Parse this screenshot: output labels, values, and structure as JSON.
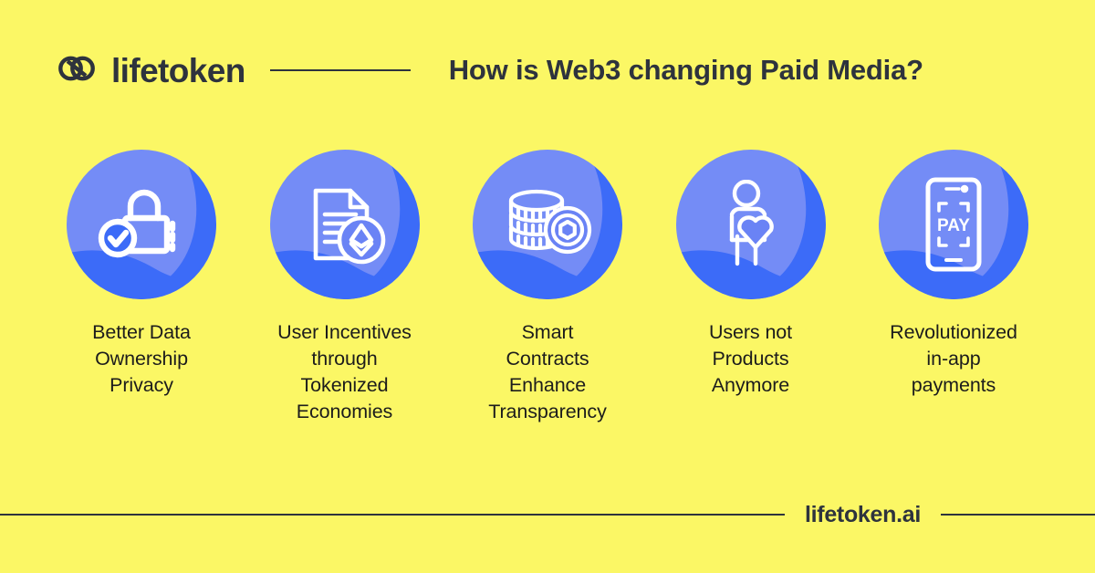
{
  "page": {
    "background_color": "#FBF765",
    "text_color": "#2E333D"
  },
  "header": {
    "brand_name": "lifetoken",
    "brand_mark_icon": "interlocking-rings-logo-icon",
    "divider_icon": "horizontal-rule",
    "headline": "How is Web3 changing Paid Media?"
  },
  "cards": [
    {
      "icon": "lock-check-icon",
      "caption": "Better Data\nOwnership\nPrivacy",
      "badge_base_color": "#748CF6",
      "badge_wave_color": "#3C6BF8"
    },
    {
      "icon": "document-ethereum-icon",
      "caption": "User Incentives\nthrough\nTokenized\nEconomies",
      "badge_base_color": "#748CF6",
      "badge_wave_color": "#3C6BF8"
    },
    {
      "icon": "coin-stack-icon",
      "caption": "Smart\nContracts\nEnhance\nTransparency",
      "badge_base_color": "#748CF6",
      "badge_wave_color": "#3C6BF8"
    },
    {
      "icon": "person-heart-icon",
      "caption": "Users not\nProducts\nAnymore",
      "badge_base_color": "#748CF6",
      "badge_wave_color": "#3C6BF8"
    },
    {
      "icon": "mobile-pay-icon",
      "caption": "Revolutionized\nin-app\npayments",
      "badge_base_color": "#748CF6",
      "badge_wave_color": "#3C6BF8",
      "icon_label": "PAY"
    }
  ],
  "footer": {
    "site": "lifetoken.ai",
    "rule_icon": "horizontal-rule"
  }
}
